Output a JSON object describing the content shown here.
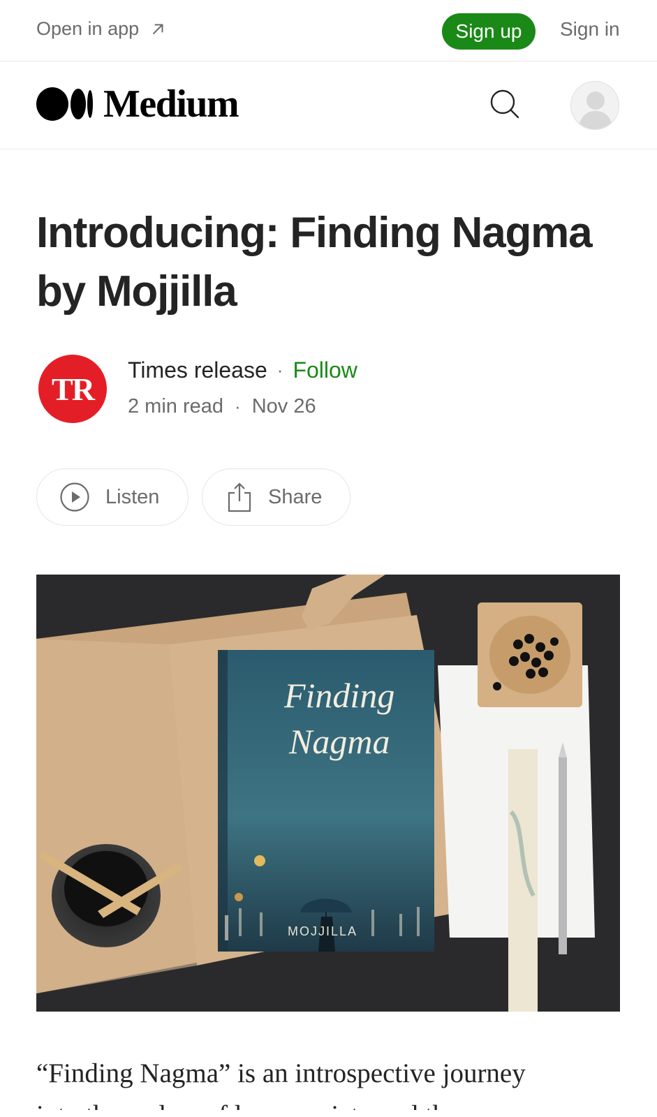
{
  "topbar": {
    "open_in_app": "Open in app",
    "sign_up": "Sign up",
    "sign_in": "Sign in"
  },
  "brand": {
    "name": "Medium",
    "accent_color": "#1a8917"
  },
  "article": {
    "title": "Introducing: Finding Nagma by Mojjilla",
    "author": {
      "initials": "TR",
      "name": "Times release",
      "follow": "Follow",
      "read_time": "2 min read",
      "date": "Nov 26",
      "badge_color": "#e41e26"
    },
    "actions": {
      "listen": "Listen",
      "share": "Share"
    },
    "hero": {
      "cover_title_line1": "Finding",
      "cover_title_line2": "Nagma",
      "cover_author": "MOJJILLA"
    },
    "body_first_line": "“Finding Nagma” is an introspective journey",
    "body_second_line": "into the realms of love, society and the unseen"
  },
  "icons": [
    "arrow-up-right-icon",
    "medium-logo-icon",
    "search-icon",
    "user-avatar-icon",
    "play-icon",
    "share-icon"
  ]
}
